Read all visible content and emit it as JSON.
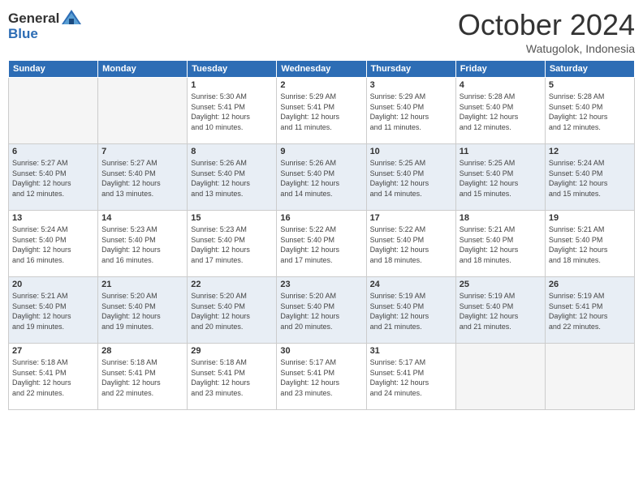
{
  "header": {
    "logo_line1": "General",
    "logo_line2": "Blue",
    "month": "October 2024",
    "location": "Watugolok, Indonesia"
  },
  "weekdays": [
    "Sunday",
    "Monday",
    "Tuesday",
    "Wednesday",
    "Thursday",
    "Friday",
    "Saturday"
  ],
  "weeks": [
    [
      {
        "day": "",
        "info": ""
      },
      {
        "day": "",
        "info": ""
      },
      {
        "day": "1",
        "info": "Sunrise: 5:30 AM\nSunset: 5:41 PM\nDaylight: 12 hours\nand 10 minutes."
      },
      {
        "day": "2",
        "info": "Sunrise: 5:29 AM\nSunset: 5:41 PM\nDaylight: 12 hours\nand 11 minutes."
      },
      {
        "day": "3",
        "info": "Sunrise: 5:29 AM\nSunset: 5:40 PM\nDaylight: 12 hours\nand 11 minutes."
      },
      {
        "day": "4",
        "info": "Sunrise: 5:28 AM\nSunset: 5:40 PM\nDaylight: 12 hours\nand 12 minutes."
      },
      {
        "day": "5",
        "info": "Sunrise: 5:28 AM\nSunset: 5:40 PM\nDaylight: 12 hours\nand 12 minutes."
      }
    ],
    [
      {
        "day": "6",
        "info": "Sunrise: 5:27 AM\nSunset: 5:40 PM\nDaylight: 12 hours\nand 12 minutes."
      },
      {
        "day": "7",
        "info": "Sunrise: 5:27 AM\nSunset: 5:40 PM\nDaylight: 12 hours\nand 13 minutes."
      },
      {
        "day": "8",
        "info": "Sunrise: 5:26 AM\nSunset: 5:40 PM\nDaylight: 12 hours\nand 13 minutes."
      },
      {
        "day": "9",
        "info": "Sunrise: 5:26 AM\nSunset: 5:40 PM\nDaylight: 12 hours\nand 14 minutes."
      },
      {
        "day": "10",
        "info": "Sunrise: 5:25 AM\nSunset: 5:40 PM\nDaylight: 12 hours\nand 14 minutes."
      },
      {
        "day": "11",
        "info": "Sunrise: 5:25 AM\nSunset: 5:40 PM\nDaylight: 12 hours\nand 15 minutes."
      },
      {
        "day": "12",
        "info": "Sunrise: 5:24 AM\nSunset: 5:40 PM\nDaylight: 12 hours\nand 15 minutes."
      }
    ],
    [
      {
        "day": "13",
        "info": "Sunrise: 5:24 AM\nSunset: 5:40 PM\nDaylight: 12 hours\nand 16 minutes."
      },
      {
        "day": "14",
        "info": "Sunrise: 5:23 AM\nSunset: 5:40 PM\nDaylight: 12 hours\nand 16 minutes."
      },
      {
        "day": "15",
        "info": "Sunrise: 5:23 AM\nSunset: 5:40 PM\nDaylight: 12 hours\nand 17 minutes."
      },
      {
        "day": "16",
        "info": "Sunrise: 5:22 AM\nSunset: 5:40 PM\nDaylight: 12 hours\nand 17 minutes."
      },
      {
        "day": "17",
        "info": "Sunrise: 5:22 AM\nSunset: 5:40 PM\nDaylight: 12 hours\nand 18 minutes."
      },
      {
        "day": "18",
        "info": "Sunrise: 5:21 AM\nSunset: 5:40 PM\nDaylight: 12 hours\nand 18 minutes."
      },
      {
        "day": "19",
        "info": "Sunrise: 5:21 AM\nSunset: 5:40 PM\nDaylight: 12 hours\nand 18 minutes."
      }
    ],
    [
      {
        "day": "20",
        "info": "Sunrise: 5:21 AM\nSunset: 5:40 PM\nDaylight: 12 hours\nand 19 minutes."
      },
      {
        "day": "21",
        "info": "Sunrise: 5:20 AM\nSunset: 5:40 PM\nDaylight: 12 hours\nand 19 minutes."
      },
      {
        "day": "22",
        "info": "Sunrise: 5:20 AM\nSunset: 5:40 PM\nDaylight: 12 hours\nand 20 minutes."
      },
      {
        "day": "23",
        "info": "Sunrise: 5:20 AM\nSunset: 5:40 PM\nDaylight: 12 hours\nand 20 minutes."
      },
      {
        "day": "24",
        "info": "Sunrise: 5:19 AM\nSunset: 5:40 PM\nDaylight: 12 hours\nand 21 minutes."
      },
      {
        "day": "25",
        "info": "Sunrise: 5:19 AM\nSunset: 5:40 PM\nDaylight: 12 hours\nand 21 minutes."
      },
      {
        "day": "26",
        "info": "Sunrise: 5:19 AM\nSunset: 5:41 PM\nDaylight: 12 hours\nand 22 minutes."
      }
    ],
    [
      {
        "day": "27",
        "info": "Sunrise: 5:18 AM\nSunset: 5:41 PM\nDaylight: 12 hours\nand 22 minutes."
      },
      {
        "day": "28",
        "info": "Sunrise: 5:18 AM\nSunset: 5:41 PM\nDaylight: 12 hours\nand 22 minutes."
      },
      {
        "day": "29",
        "info": "Sunrise: 5:18 AM\nSunset: 5:41 PM\nDaylight: 12 hours\nand 23 minutes."
      },
      {
        "day": "30",
        "info": "Sunrise: 5:17 AM\nSunset: 5:41 PM\nDaylight: 12 hours\nand 23 minutes."
      },
      {
        "day": "31",
        "info": "Sunrise: 5:17 AM\nSunset: 5:41 PM\nDaylight: 12 hours\nand 24 minutes."
      },
      {
        "day": "",
        "info": ""
      },
      {
        "day": "",
        "info": ""
      }
    ]
  ]
}
